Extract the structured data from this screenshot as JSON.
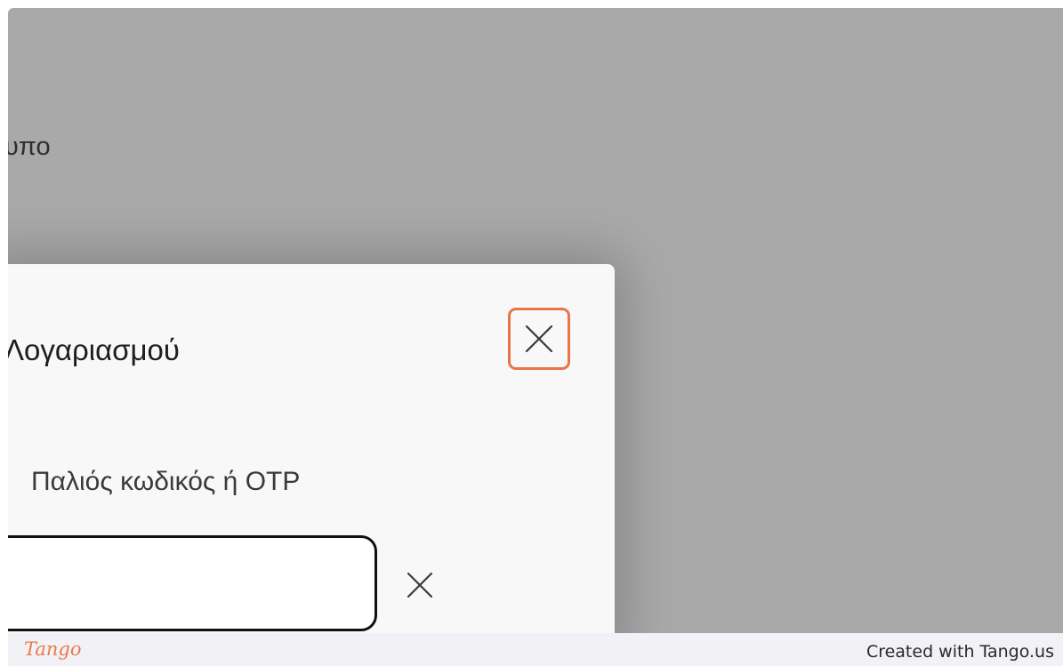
{
  "background": {
    "partial_text": "υπο"
  },
  "dialog": {
    "title_partial": "Λογαριασμού",
    "close_icon": "close-icon",
    "field_label": "Παλιός κωδικός ή OTP",
    "field_value": "",
    "clear_icon": "close-icon"
  },
  "footer": {
    "logo": "Tango",
    "credit": "Created with Tango.us"
  },
  "colors": {
    "overlay": "#a9a9a9",
    "dialog_bg": "#f8f8f9",
    "highlight": "#e8754a",
    "footer_bg": "#f2f2f6"
  }
}
